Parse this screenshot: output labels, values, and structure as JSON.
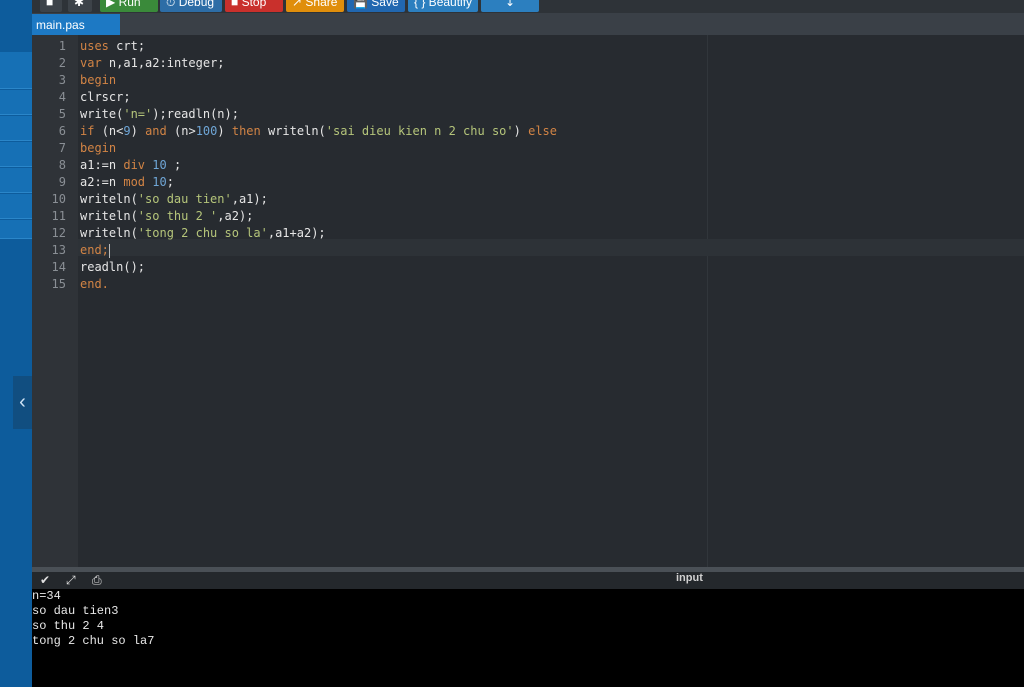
{
  "toolbar": {
    "buttons": [
      {
        "label": "Run",
        "icon": "play-icon",
        "color": "#3a8a3a"
      },
      {
        "label": "Debug",
        "icon": "debug-icon",
        "color": "#2d6da6"
      },
      {
        "label": "Stop",
        "icon": "stop-icon",
        "color": "#c9302c"
      },
      {
        "label": "Share",
        "icon": "share-icon",
        "color": "#e08e0b"
      },
      {
        "label": "Save",
        "icon": "save-icon",
        "color": "#2167b0"
      },
      {
        "label": "{ } Beautify",
        "icon": "",
        "color": "#2c7fbf"
      }
    ]
  },
  "tab": {
    "filename": "main.pas"
  },
  "editor": {
    "line_numbers": [
      "1",
      "2",
      "3",
      "4",
      "5",
      "6",
      "7",
      "8",
      "9",
      "10",
      "11",
      "12",
      "13",
      "14",
      "15"
    ]
  },
  "output": {
    "input_label": "input",
    "lines": [
      "n=34",
      "so dau tien3",
      "so thu 2 4",
      "tong 2 chu so la7"
    ]
  },
  "colors": {
    "keyword": "#d28445",
    "string": "#b5c57a",
    "number": "#6fa6d6",
    "editor_bg": "#272b30",
    "accent": "#1d79c4"
  }
}
